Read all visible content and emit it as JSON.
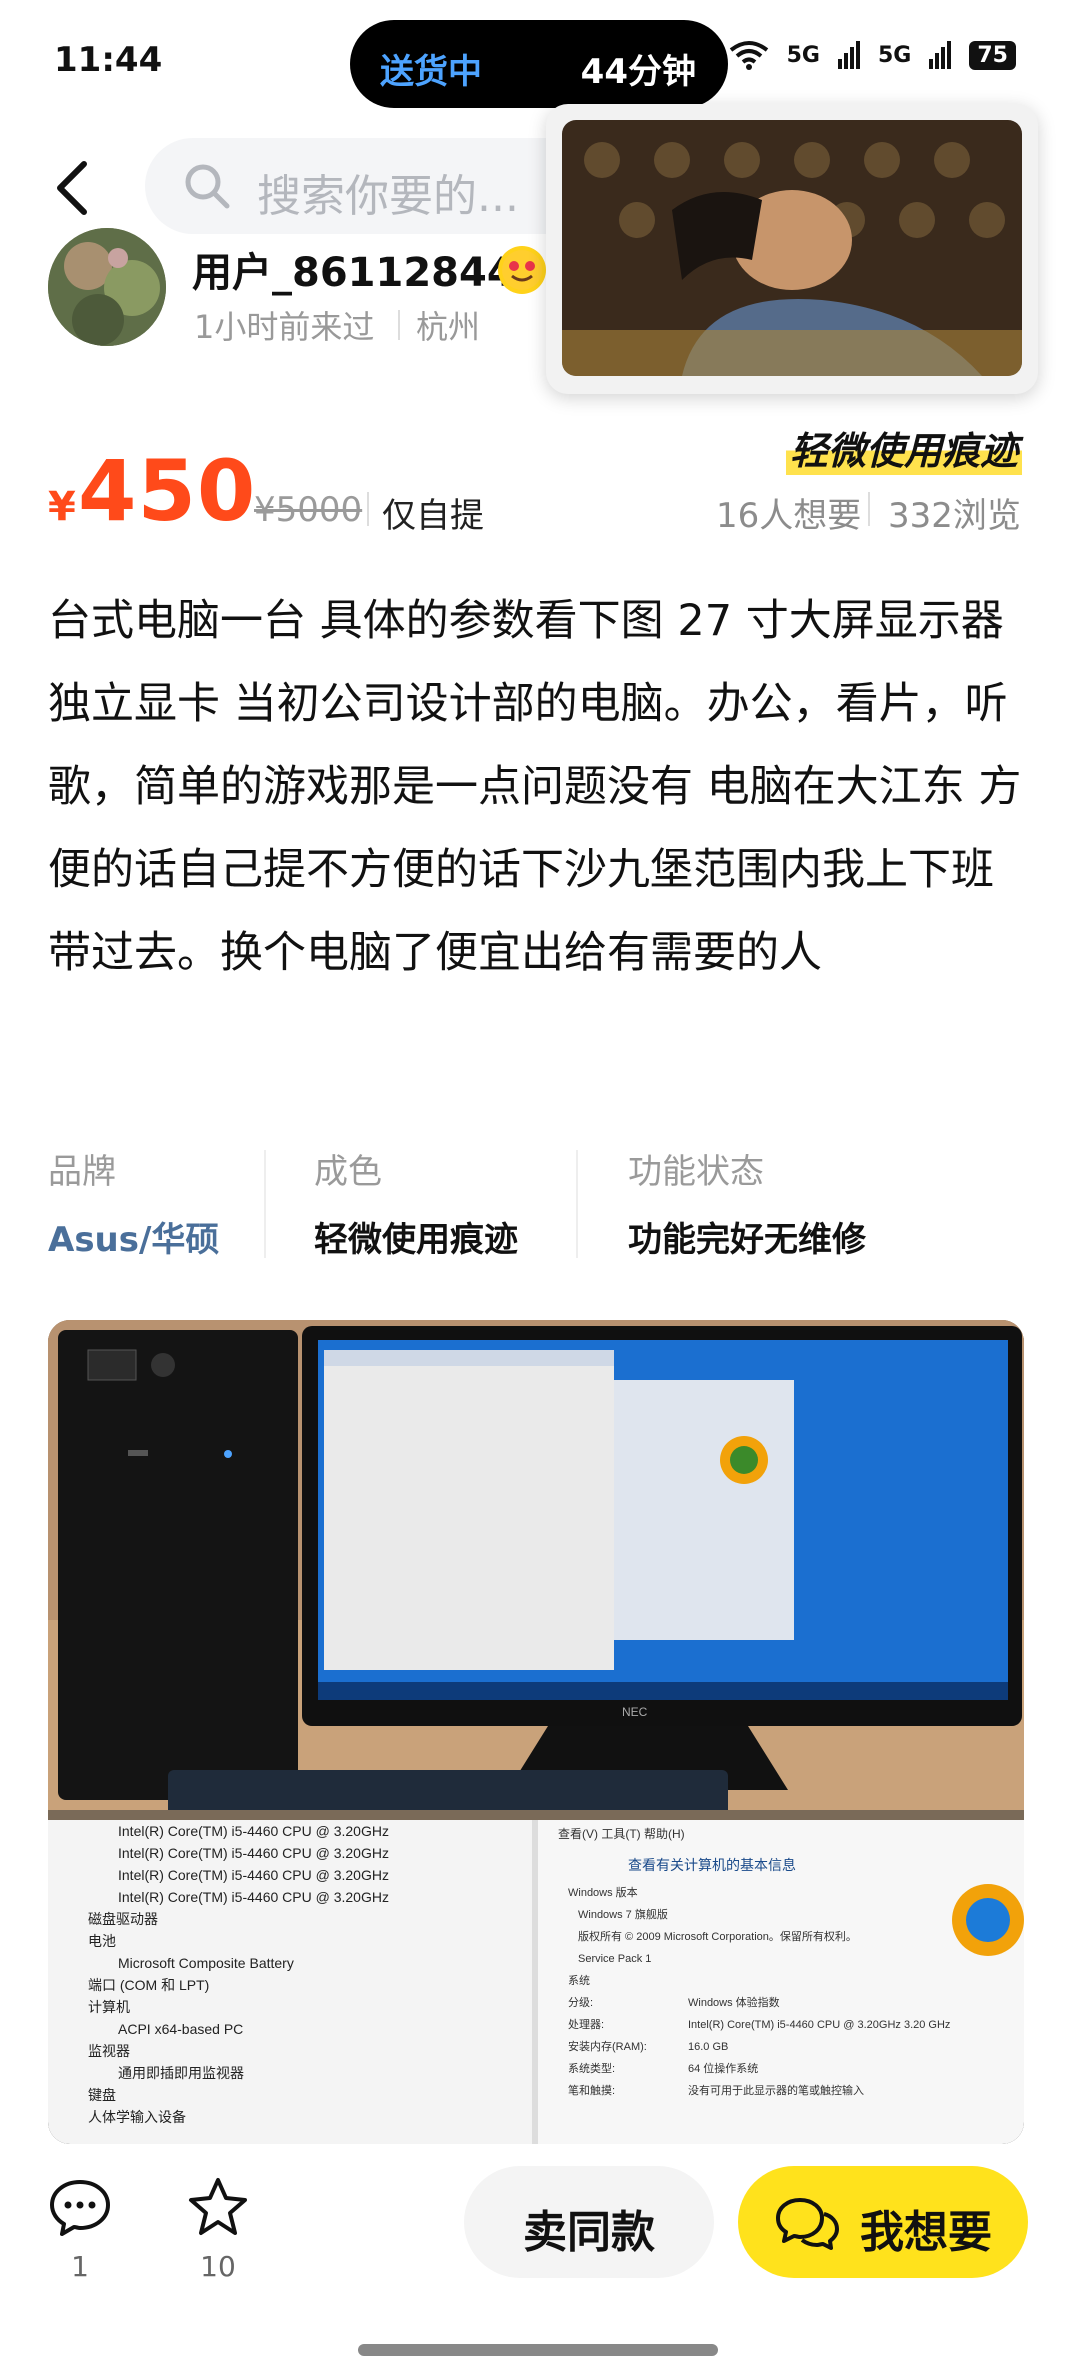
{
  "status": {
    "time": "11:44",
    "island_left": "送货中",
    "island_right": "44分钟",
    "battery": "75",
    "net1": "5G",
    "net2": "5G"
  },
  "header": {
    "search_placeholder": "搜索你要的..."
  },
  "user": {
    "name": "用户_86112844",
    "last_seen": "1小时前来过",
    "city": "杭州"
  },
  "price": {
    "currency": "¥",
    "current": "450",
    "original": "¥5000",
    "delivery": "仅自提",
    "condition_tag": "轻微使用痕迹",
    "want_count": "16人想要",
    "view_count": "332浏览"
  },
  "description": "台式电脑一台 具体的参数看下图  27 寸大屏显示器  独立显卡 当初公司设计部的电脑。办公，看片，听歌，简单的游戏那是一点问题没有  电脑在大江东 方便的话自己提不方便的话下沙九堡范围内我上下班带过去。换个电脑了便宜出给有需要的人",
  "attributes": [
    {
      "key": "品牌",
      "value": "Asus/华硕"
    },
    {
      "key": "成色",
      "value": "轻微使用痕迹"
    },
    {
      "key": "功能状态",
      "value": "功能完好无维修"
    }
  ],
  "photo": {
    "device_list": [
      "Intel(R) Core(TM) i5-4460  CPU @ 3.20GHz",
      "Intel(R) Core(TM) i5-4460  CPU @ 3.20GHz",
      "Intel(R) Core(TM) i5-4460  CPU @ 3.20GHz",
      "Intel(R) Core(TM) i5-4460  CPU @ 3.20GHz",
      "磁盘驱动器",
      "电池",
      "Microsoft Composite Battery",
      "端口 (COM 和 LPT)",
      "计算机",
      "ACPI x64-based PC",
      "监视器",
      "通用即插即用监视器",
      "键盘",
      "人体学输入设备"
    ],
    "sysinfo_title": "查看有关计算机的基本信息",
    "sysinfo_lines": [
      "Windows 版本",
      "Windows 7 旗舰版",
      "版权所有 © 2009 Microsoft Corporation。保留所有权利。",
      "Service Pack 1",
      "系统",
      "分级:",
      "处理器:",
      "安装内存(RAM):",
      "系统类型:",
      "笔和触摸:"
    ],
    "sysinfo_values": [
      "Windows 体验指数",
      "Intel(R) Core(TM) i5-4460  CPU @ 3.20GHz  3.20 GHz",
      "16.0 GB",
      "64 位操作系统",
      "没有可用于此显示器的笔或触控输入"
    ],
    "menu": "查看(V)  工具(T)  帮助(H)",
    "monitor_brand": "NEC"
  },
  "bottom_bar": {
    "comment_count": "1",
    "fav_count": "10",
    "same_label": "卖同款",
    "want_label": "我想要"
  }
}
